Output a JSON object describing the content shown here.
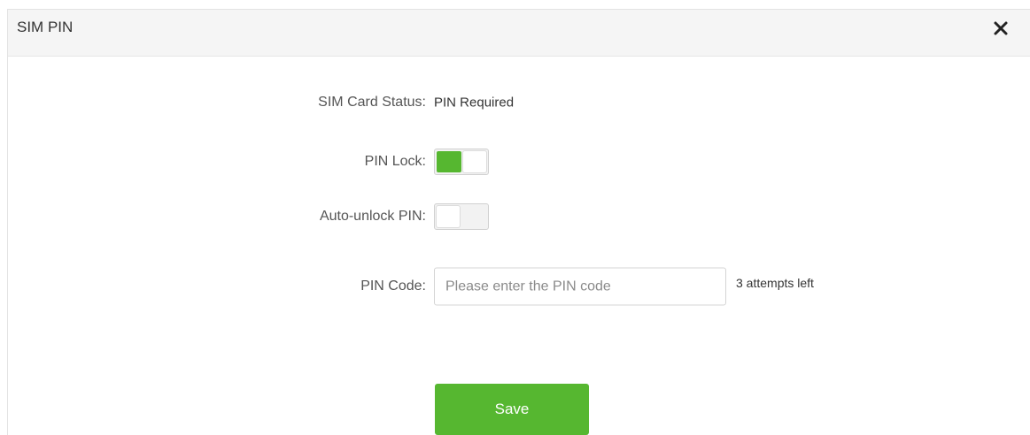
{
  "dialog": {
    "title": "SIM PIN",
    "close_icon": "close-icon"
  },
  "form": {
    "sim_status": {
      "label": "SIM Card Status:",
      "value": "PIN Required"
    },
    "pin_lock": {
      "label": "PIN Lock:",
      "enabled": true
    },
    "auto_unlock": {
      "label": "Auto-unlock PIN:",
      "enabled": false
    },
    "pin_code": {
      "label": "PIN Code:",
      "value": "",
      "placeholder": "Please enter the PIN code",
      "attempts_text": "3 attempts left"
    }
  },
  "actions": {
    "save_label": "Save"
  },
  "colors": {
    "accent": "#56b730",
    "header_bg": "#f5f5f5"
  }
}
